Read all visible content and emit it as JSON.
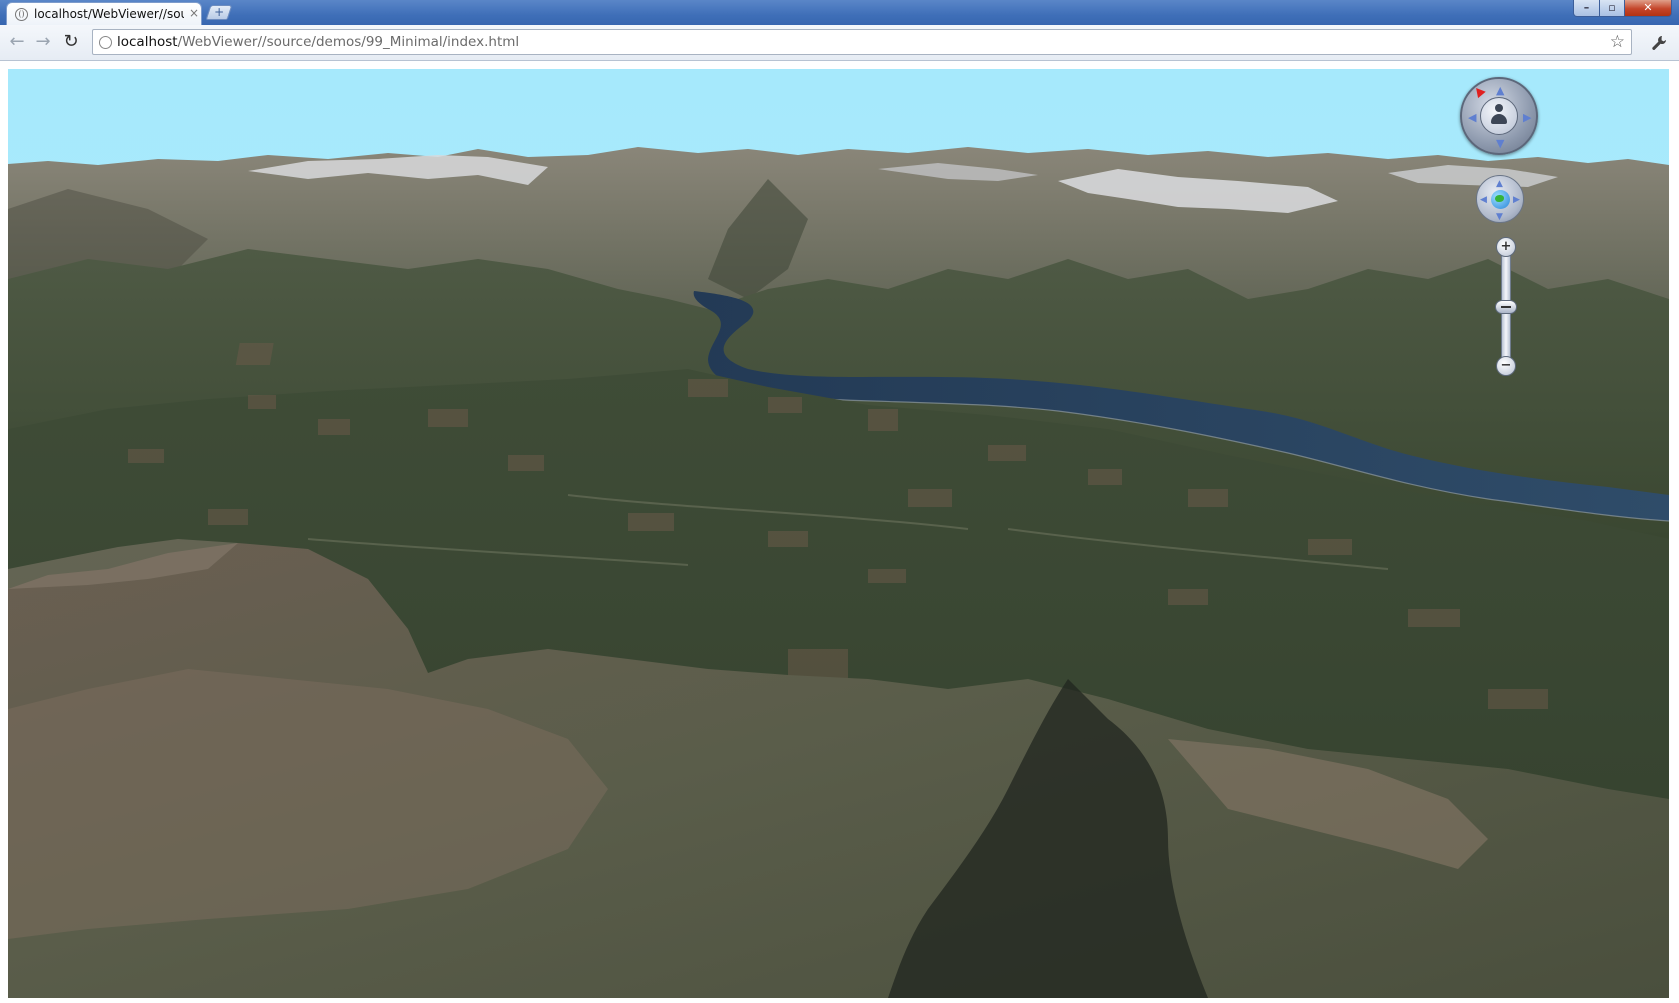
{
  "browser": {
    "tab": {
      "title": "localhost/WebViewer//sour",
      "close_glyph": "×"
    },
    "new_tab_glyph": "+",
    "window_controls": {
      "minimize": "–",
      "maximize": "▫",
      "close": "✕"
    },
    "nav": {
      "back": "←",
      "forward": "→",
      "reload": "↻"
    },
    "url": {
      "host": "localhost",
      "path": "/WebViewer//source/demos/99_Minimal/index.html"
    },
    "star_glyph": "☆",
    "wrench_glyph": "🔧"
  },
  "map_controls": {
    "compass_icon": "person-navigation-icon",
    "globe_icon": "globe-icon",
    "zoom_in_glyph": "+",
    "zoom_out_glyph": "−",
    "zoom_level": 0.5
  },
  "colors": {
    "sky": "#a9e8fb",
    "lake": "#2c4560",
    "forest": "#3b4a36",
    "snow": "#dcdde0",
    "rock": "#6e6556",
    "titlebar": "#3f6fb8"
  }
}
